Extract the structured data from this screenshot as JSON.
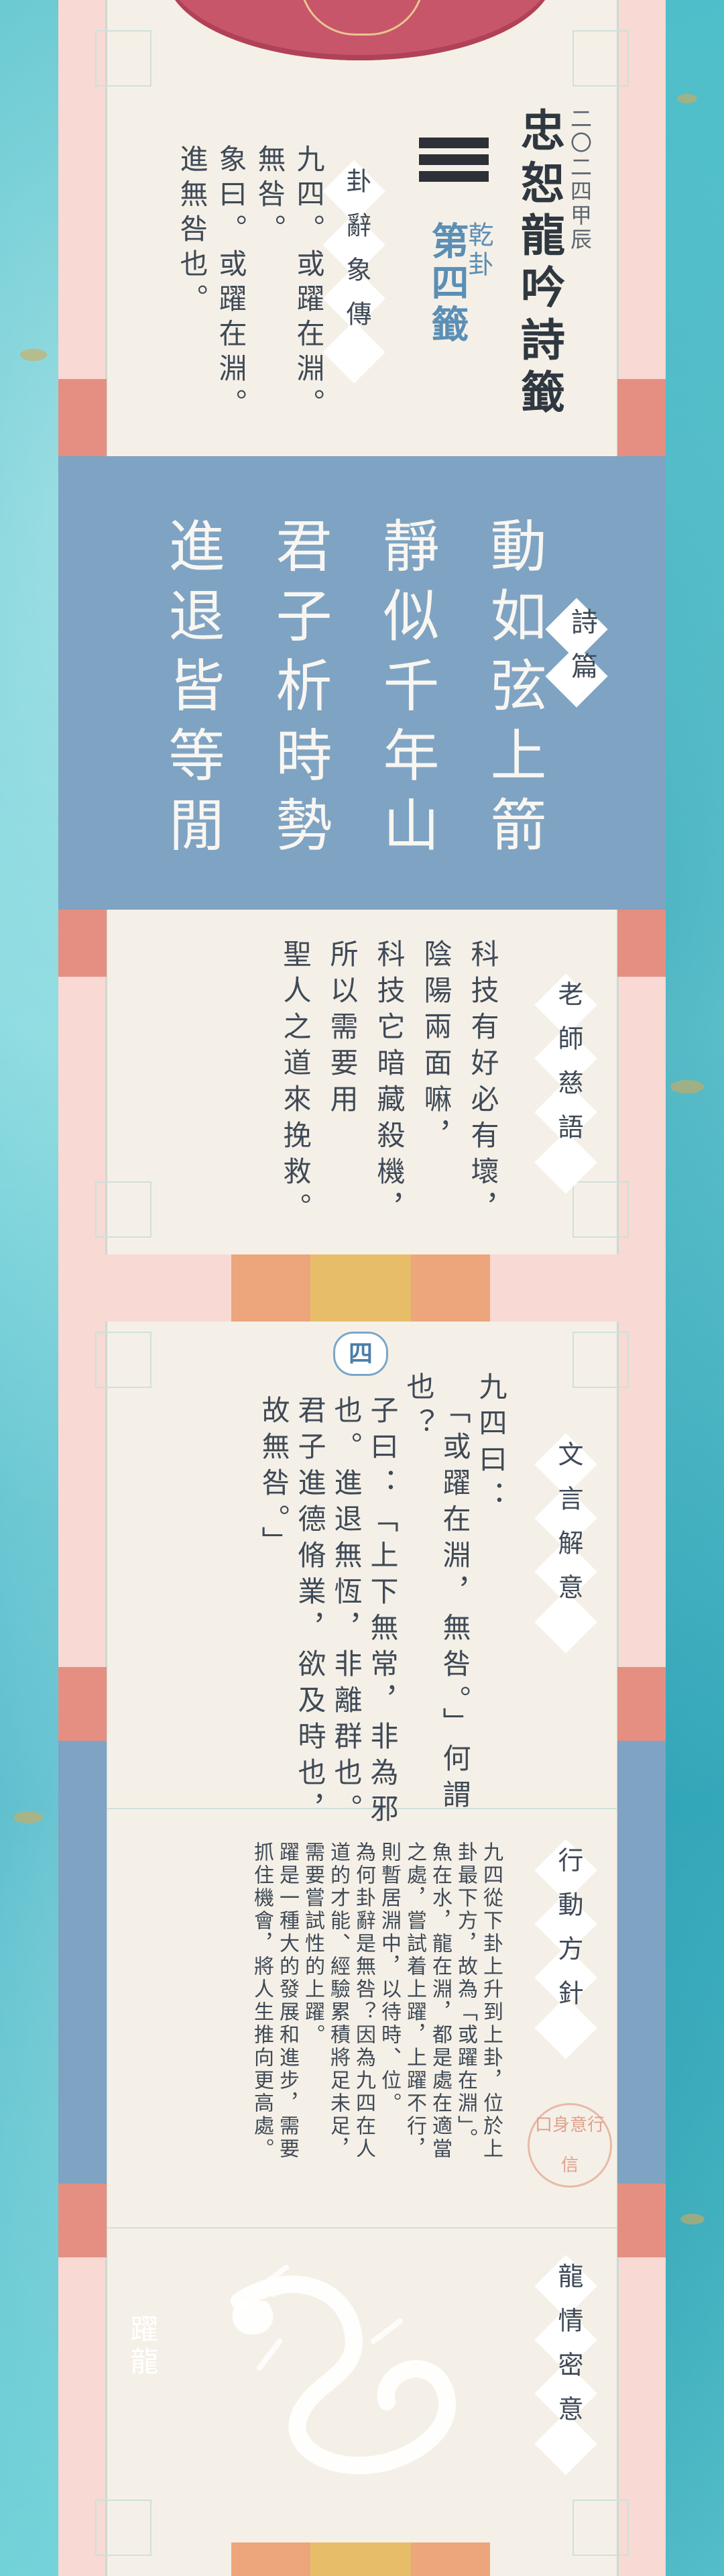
{
  "header": {
    "date": "二〇二四甲辰",
    "title": "忠恕龍吟詩籤",
    "trigram_lines": 3,
    "gua": "乾卦",
    "number": "第四籤",
    "badge": "卦辭象傳",
    "text_lines": [
      "九四。或躍在淵。",
      "無咎。",
      "象曰。或躍在淵。",
      "進無咎也。"
    ]
  },
  "poem": {
    "badge": "詩篇",
    "lines": [
      "動如弦上箭",
      "靜似千年山",
      "君子析時勢",
      "進退皆等閒"
    ]
  },
  "teacher": {
    "badge": "老師慈語",
    "lines": [
      "科技有好必有壞，",
      "陰陽兩面嘛，",
      "科技它暗藏殺機，",
      "所以需要用",
      "聖人之道來挽救。"
    ]
  },
  "section_number": "四",
  "wenyan": {
    "badge": "文言解意",
    "lines": [
      "九四曰：",
      "「或躍在淵，無咎。」何謂",
      "也？",
      "子曰：「上下無常，非為邪",
      "也。進退無恆，非離群也。",
      "君子進德脩業，欲及時也，",
      "故無咎。」"
    ]
  },
  "action": {
    "badge": "行動方針",
    "stamp": [
      "口",
      "身",
      "意",
      "行",
      "信"
    ],
    "lines": [
      "九四從下卦上升到上卦，位於上",
      "卦最下方，故為「或躍在淵」。",
      "魚在水，龍在淵，都是處在適當",
      "之處，嘗試着上躍，上躍不行，",
      "則暫居淵中，以待時、位。",
      "為何卦辭是無咎？因為九四在人",
      "道的才能、經驗累積將足未足，",
      "需要嘗試性的上躍。",
      "躍是一種大的發展和進步，需要",
      "抓住機會，將人生推向更高處。"
    ]
  },
  "dragon": {
    "badge": "龍情密意",
    "label": "躍龍"
  },
  "colors": {
    "accent_blue": "#7fa3c2",
    "accent_red": "#e58f83",
    "gold": "#e8bd6a",
    "cream": "#f5f0e7"
  }
}
